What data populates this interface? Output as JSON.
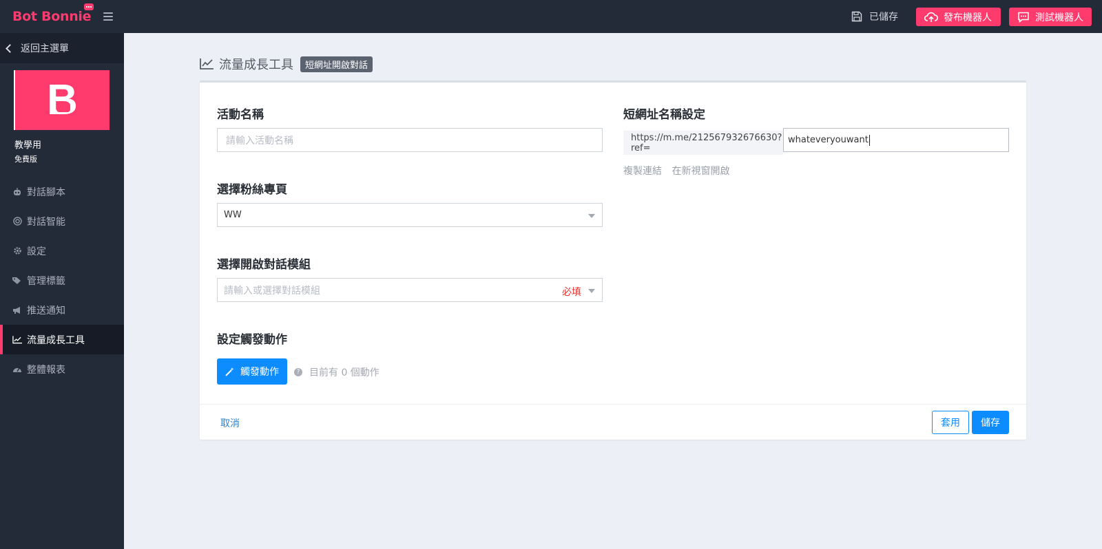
{
  "brand": {
    "logo": "Bot Bonnie"
  },
  "sidebar": {
    "back_label": "返回主選單",
    "bot_initial": "B",
    "bot_name": "教學用",
    "bot_plan": "免費版",
    "items": [
      {
        "label": "對話腳本",
        "icon": "robot-icon"
      },
      {
        "label": "對話智能",
        "icon": "target-icon"
      },
      {
        "label": "設定",
        "icon": "gear-icon"
      },
      {
        "label": "管理標籤",
        "icon": "tags-icon"
      },
      {
        "label": "推送通知",
        "icon": "megaphone-icon"
      },
      {
        "label": "流量成長工具",
        "icon": "line-chart-icon",
        "active": true
      },
      {
        "label": "整體報表",
        "icon": "dashboard-icon"
      }
    ]
  },
  "topbar": {
    "saved_label": "已儲存",
    "publish_label": "發布機器人",
    "test_label": "測試機器人"
  },
  "page": {
    "title": "流量成長工具",
    "tag": "短網址開啟對話"
  },
  "form": {
    "campaign_label": "活動名稱",
    "campaign_placeholder": "請輸入活動名稱",
    "fanpage_label": "選擇粉絲專頁",
    "fanpage_value": "WW",
    "module_label": "選擇開啟對話模組",
    "module_placeholder": "請輸入或選擇對話模組",
    "module_required": "必填",
    "trigger_label": "設定觸發動作",
    "trigger_button": "觸發動作",
    "trigger_hint": "目前有 0 個動作",
    "shorturl_label": "短網址名稱設定",
    "shorturl_prefix": "https://m.me/212567932676630?ref=",
    "shorturl_value": "whateveryouwant",
    "copy_link": "複製連結",
    "open_new_window": "在新視窗開啟"
  },
  "footer": {
    "cancel_label": "取消",
    "apply_label": "套用",
    "save_label": "儲存"
  },
  "colors": {
    "accent_pink": "#ff3b6e",
    "primary_blue": "#0d8cff",
    "sidebar_bg": "#232a38",
    "page_bg": "#eceff6"
  }
}
